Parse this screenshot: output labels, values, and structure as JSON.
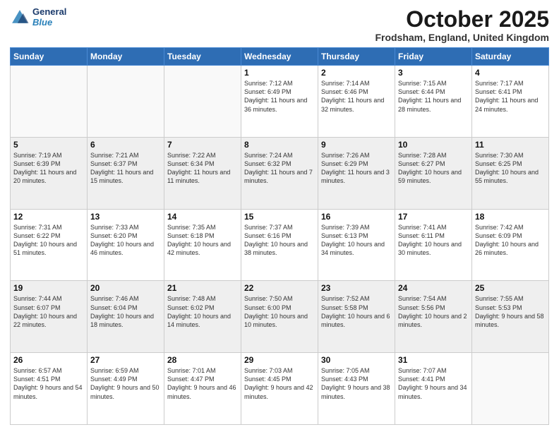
{
  "header": {
    "logo_line1": "General",
    "logo_line2": "Blue",
    "month_title": "October 2025",
    "location": "Frodsham, England, United Kingdom"
  },
  "days_of_week": [
    "Sunday",
    "Monday",
    "Tuesday",
    "Wednesday",
    "Thursday",
    "Friday",
    "Saturday"
  ],
  "weeks": [
    [
      {
        "day": "",
        "sunrise": "",
        "sunset": "",
        "daylight": "",
        "empty": true
      },
      {
        "day": "",
        "sunrise": "",
        "sunset": "",
        "daylight": "",
        "empty": true
      },
      {
        "day": "",
        "sunrise": "",
        "sunset": "",
        "daylight": "",
        "empty": true
      },
      {
        "day": "1",
        "sunrise": "Sunrise: 7:12 AM",
        "sunset": "Sunset: 6:49 PM",
        "daylight": "Daylight: 11 hours and 36 minutes."
      },
      {
        "day": "2",
        "sunrise": "Sunrise: 7:14 AM",
        "sunset": "Sunset: 6:46 PM",
        "daylight": "Daylight: 11 hours and 32 minutes."
      },
      {
        "day": "3",
        "sunrise": "Sunrise: 7:15 AM",
        "sunset": "Sunset: 6:44 PM",
        "daylight": "Daylight: 11 hours and 28 minutes."
      },
      {
        "day": "4",
        "sunrise": "Sunrise: 7:17 AM",
        "sunset": "Sunset: 6:41 PM",
        "daylight": "Daylight: 11 hours and 24 minutes."
      }
    ],
    [
      {
        "day": "5",
        "sunrise": "Sunrise: 7:19 AM",
        "sunset": "Sunset: 6:39 PM",
        "daylight": "Daylight: 11 hours and 20 minutes."
      },
      {
        "day": "6",
        "sunrise": "Sunrise: 7:21 AM",
        "sunset": "Sunset: 6:37 PM",
        "daylight": "Daylight: 11 hours and 15 minutes."
      },
      {
        "day": "7",
        "sunrise": "Sunrise: 7:22 AM",
        "sunset": "Sunset: 6:34 PM",
        "daylight": "Daylight: 11 hours and 11 minutes."
      },
      {
        "day": "8",
        "sunrise": "Sunrise: 7:24 AM",
        "sunset": "Sunset: 6:32 PM",
        "daylight": "Daylight: 11 hours and 7 minutes."
      },
      {
        "day": "9",
        "sunrise": "Sunrise: 7:26 AM",
        "sunset": "Sunset: 6:29 PM",
        "daylight": "Daylight: 11 hours and 3 minutes."
      },
      {
        "day": "10",
        "sunrise": "Sunrise: 7:28 AM",
        "sunset": "Sunset: 6:27 PM",
        "daylight": "Daylight: 10 hours and 59 minutes."
      },
      {
        "day": "11",
        "sunrise": "Sunrise: 7:30 AM",
        "sunset": "Sunset: 6:25 PM",
        "daylight": "Daylight: 10 hours and 55 minutes."
      }
    ],
    [
      {
        "day": "12",
        "sunrise": "Sunrise: 7:31 AM",
        "sunset": "Sunset: 6:22 PM",
        "daylight": "Daylight: 10 hours and 51 minutes."
      },
      {
        "day": "13",
        "sunrise": "Sunrise: 7:33 AM",
        "sunset": "Sunset: 6:20 PM",
        "daylight": "Daylight: 10 hours and 46 minutes."
      },
      {
        "day": "14",
        "sunrise": "Sunrise: 7:35 AM",
        "sunset": "Sunset: 6:18 PM",
        "daylight": "Daylight: 10 hours and 42 minutes."
      },
      {
        "day": "15",
        "sunrise": "Sunrise: 7:37 AM",
        "sunset": "Sunset: 6:16 PM",
        "daylight": "Daylight: 10 hours and 38 minutes."
      },
      {
        "day": "16",
        "sunrise": "Sunrise: 7:39 AM",
        "sunset": "Sunset: 6:13 PM",
        "daylight": "Daylight: 10 hours and 34 minutes."
      },
      {
        "day": "17",
        "sunrise": "Sunrise: 7:41 AM",
        "sunset": "Sunset: 6:11 PM",
        "daylight": "Daylight: 10 hours and 30 minutes."
      },
      {
        "day": "18",
        "sunrise": "Sunrise: 7:42 AM",
        "sunset": "Sunset: 6:09 PM",
        "daylight": "Daylight: 10 hours and 26 minutes."
      }
    ],
    [
      {
        "day": "19",
        "sunrise": "Sunrise: 7:44 AM",
        "sunset": "Sunset: 6:07 PM",
        "daylight": "Daylight: 10 hours and 22 minutes."
      },
      {
        "day": "20",
        "sunrise": "Sunrise: 7:46 AM",
        "sunset": "Sunset: 6:04 PM",
        "daylight": "Daylight: 10 hours and 18 minutes."
      },
      {
        "day": "21",
        "sunrise": "Sunrise: 7:48 AM",
        "sunset": "Sunset: 6:02 PM",
        "daylight": "Daylight: 10 hours and 14 minutes."
      },
      {
        "day": "22",
        "sunrise": "Sunrise: 7:50 AM",
        "sunset": "Sunset: 6:00 PM",
        "daylight": "Daylight: 10 hours and 10 minutes."
      },
      {
        "day": "23",
        "sunrise": "Sunrise: 7:52 AM",
        "sunset": "Sunset: 5:58 PM",
        "daylight": "Daylight: 10 hours and 6 minutes."
      },
      {
        "day": "24",
        "sunrise": "Sunrise: 7:54 AM",
        "sunset": "Sunset: 5:56 PM",
        "daylight": "Daylight: 10 hours and 2 minutes."
      },
      {
        "day": "25",
        "sunrise": "Sunrise: 7:55 AM",
        "sunset": "Sunset: 5:53 PM",
        "daylight": "Daylight: 9 hours and 58 minutes."
      }
    ],
    [
      {
        "day": "26",
        "sunrise": "Sunrise: 6:57 AM",
        "sunset": "Sunset: 4:51 PM",
        "daylight": "Daylight: 9 hours and 54 minutes."
      },
      {
        "day": "27",
        "sunrise": "Sunrise: 6:59 AM",
        "sunset": "Sunset: 4:49 PM",
        "daylight": "Daylight: 9 hours and 50 minutes."
      },
      {
        "day": "28",
        "sunrise": "Sunrise: 7:01 AM",
        "sunset": "Sunset: 4:47 PM",
        "daylight": "Daylight: 9 hours and 46 minutes."
      },
      {
        "day": "29",
        "sunrise": "Sunrise: 7:03 AM",
        "sunset": "Sunset: 4:45 PM",
        "daylight": "Daylight: 9 hours and 42 minutes."
      },
      {
        "day": "30",
        "sunrise": "Sunrise: 7:05 AM",
        "sunset": "Sunset: 4:43 PM",
        "daylight": "Daylight: 9 hours and 38 minutes."
      },
      {
        "day": "31",
        "sunrise": "Sunrise: 7:07 AM",
        "sunset": "Sunset: 4:41 PM",
        "daylight": "Daylight: 9 hours and 34 minutes."
      },
      {
        "day": "",
        "sunrise": "",
        "sunset": "",
        "daylight": "",
        "empty": true
      }
    ]
  ]
}
